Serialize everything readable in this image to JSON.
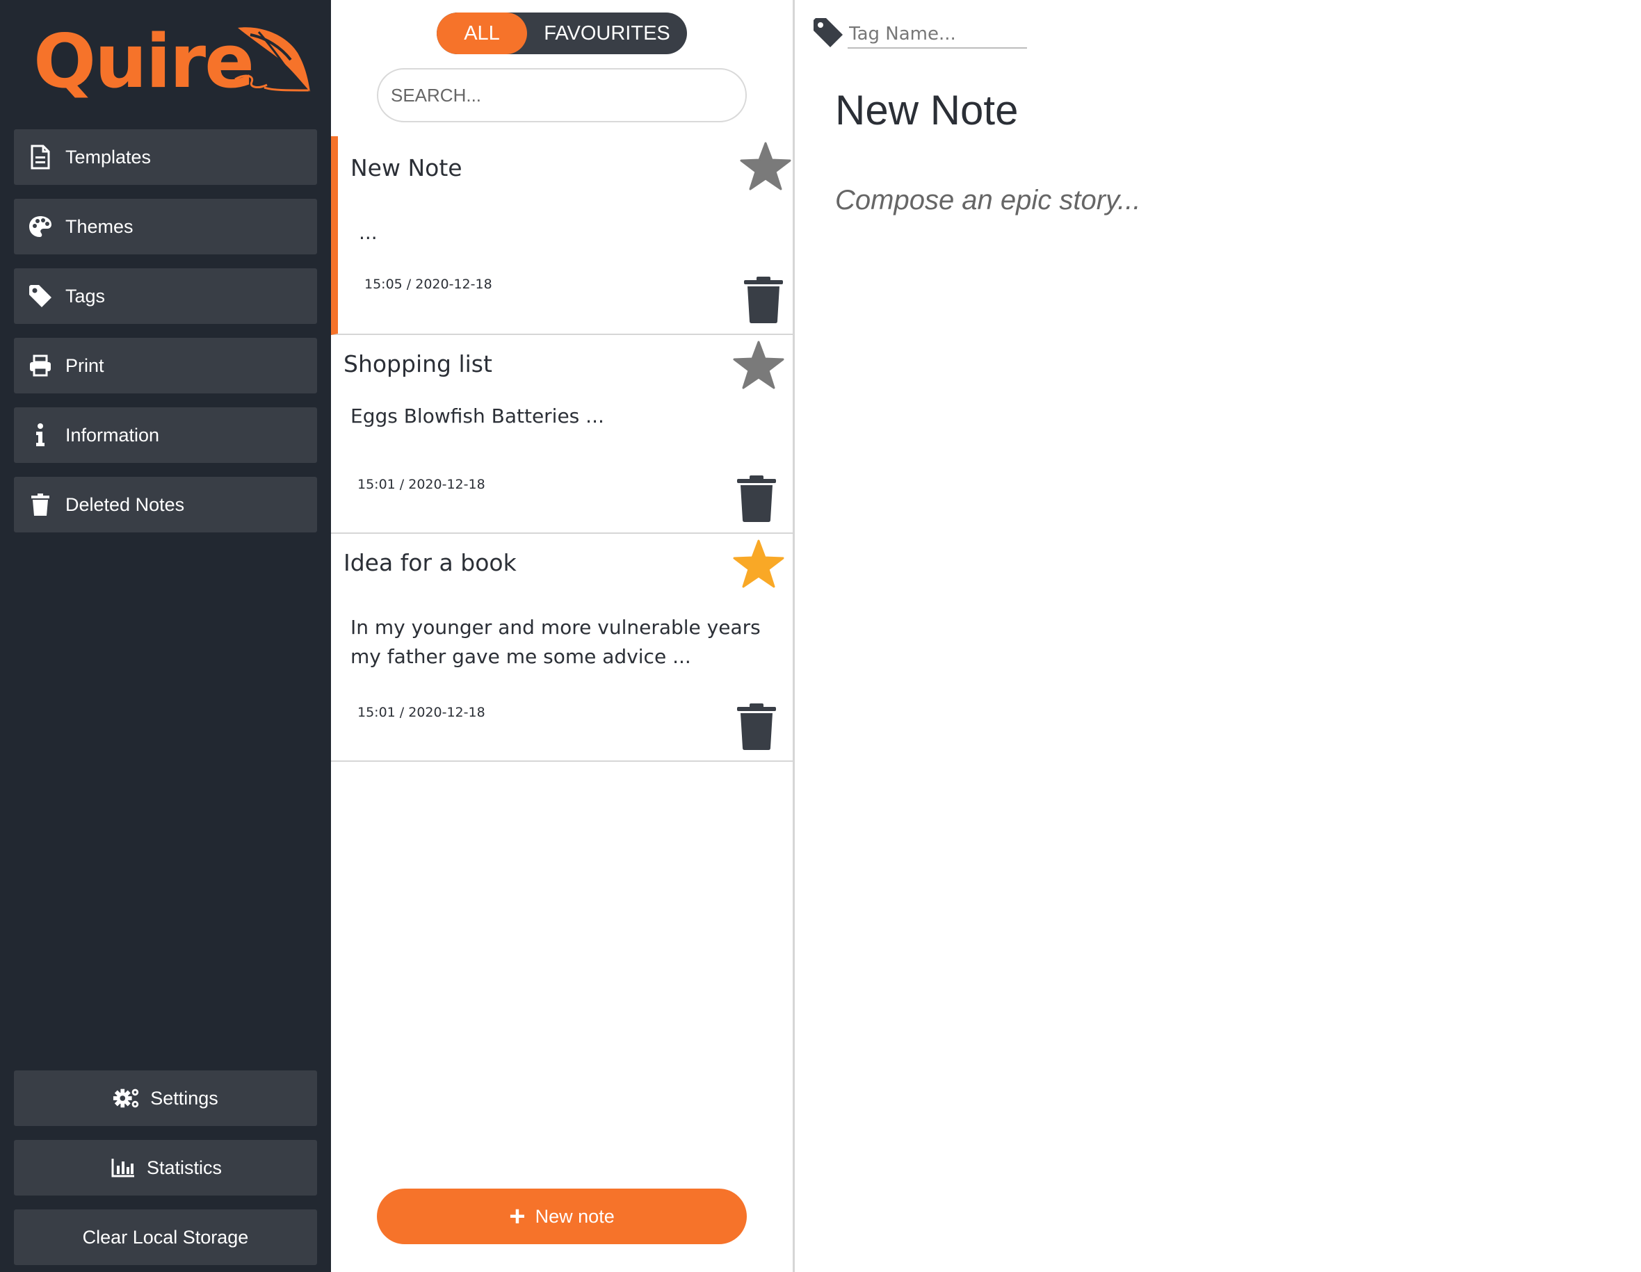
{
  "app": {
    "logo_text": "Quire",
    "accent_color": "#f6732a",
    "sidebar_color": "#222831",
    "button_color": "#393e46"
  },
  "sidebar": {
    "items": [
      {
        "label": "Templates",
        "icon": "document-icon"
      },
      {
        "label": "Themes",
        "icon": "palette-icon"
      },
      {
        "label": "Tags",
        "icon": "tag-icon"
      },
      {
        "label": "Print",
        "icon": "printer-icon"
      },
      {
        "label": "Information",
        "icon": "info-icon"
      },
      {
        "label": "Deleted Notes",
        "icon": "trash-icon"
      }
    ],
    "bottom": [
      {
        "label": "Settings",
        "icon": "gears-icon"
      },
      {
        "label": "Statistics",
        "icon": "bar-chart-icon"
      },
      {
        "label": "Clear Local Storage"
      }
    ]
  },
  "filter": {
    "all": "ALL",
    "favourites": "FAVOURITES",
    "active": "all"
  },
  "search": {
    "placeholder": "SEARCH..."
  },
  "notes": [
    {
      "title": "New Note",
      "preview": "...",
      "time": "15:05 / 2020-12-18",
      "favourite": false,
      "active": true
    },
    {
      "title": "Shopping list",
      "preview": "Eggs Blowfish Batteries ...",
      "time": "15:01 / 2020-12-18",
      "favourite": false,
      "active": false
    },
    {
      "title": "Idea for a book",
      "preview": "In my younger and more vulnerable years my father gave me some advice ...",
      "time": "15:01 / 2020-12-18",
      "favourite": true,
      "active": false
    }
  ],
  "new_note_label": "New note",
  "editor": {
    "tag_placeholder": "Tag Name...",
    "title": "New Note",
    "body_placeholder": "Compose an epic story..."
  },
  "colors": {
    "star_off": "#7a7a7a",
    "star_on": "#f9a826",
    "trash": "#393e46"
  }
}
